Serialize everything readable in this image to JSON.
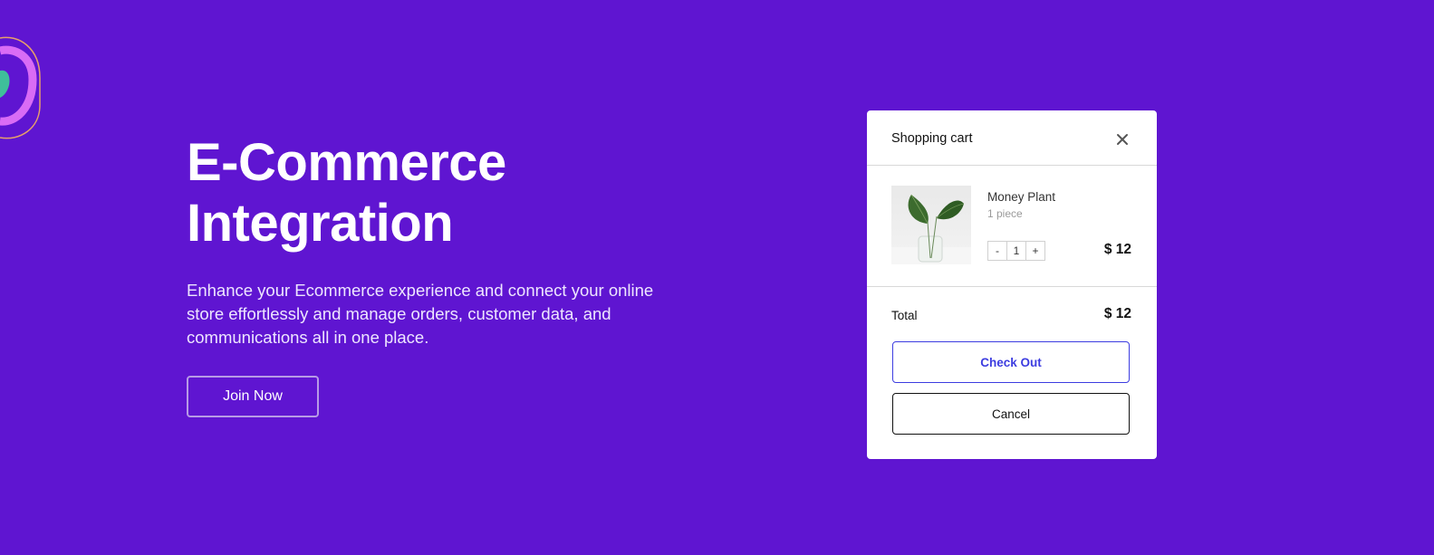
{
  "hero": {
    "title_line1": "E-Commerce",
    "title_line2": "Integration",
    "description": "Enhance your Ecommerce experience and connect your online store effortlessly and manage orders, customer data, and communications all in one place.",
    "join_label": "Join Now"
  },
  "cart": {
    "title": "Shopping cart",
    "close_icon": "close-icon",
    "item": {
      "name": "Money Plant",
      "quantity_text": "1 piece",
      "decrement_label": "-",
      "quantity_value": "1",
      "increment_label": "+",
      "price": "$ 12",
      "image_icon": "plant-image"
    },
    "total_label": "Total",
    "total_value": "$ 12",
    "checkout_label": "Check Out",
    "cancel_label": "Cancel"
  },
  "colors": {
    "background": "#5f15d1",
    "accent": "#3d3de0",
    "logo_pink": "#d96cf5",
    "logo_green": "#3fbf9a"
  }
}
